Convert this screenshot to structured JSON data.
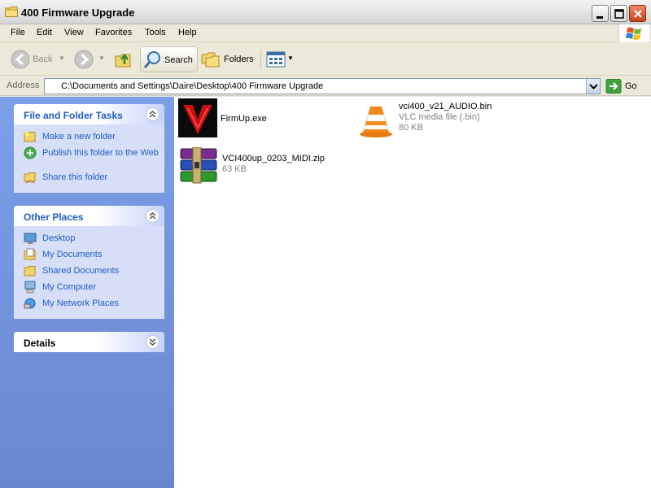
{
  "window": {
    "title": "400 Firmware Upgrade"
  },
  "menu": [
    "File",
    "Edit",
    "View",
    "Favorites",
    "Tools",
    "Help"
  ],
  "toolbar": {
    "back": "Back",
    "search": "Search",
    "folders": "Folders"
  },
  "address": {
    "label": "Address",
    "path": "C:\\Documents and Settings\\Daire\\Desktop\\400 Firmware Upgrade",
    "go": "Go"
  },
  "sidebar": {
    "tasks": {
      "title": "File and Folder Tasks",
      "items": [
        "Make a new folder",
        "Publish this folder to the Web",
        "Share this folder"
      ]
    },
    "places": {
      "title": "Other Places",
      "items": [
        "Desktop",
        "My Documents",
        "Shared Documents",
        "My Computer",
        "My Network Places"
      ]
    },
    "details": {
      "title": "Details"
    }
  },
  "files": [
    {
      "name": "FirmUp.exe",
      "type": "",
      "size": "",
      "icon": "firmup-app-icon"
    },
    {
      "name": "vci400_v21_AUDIO.bin",
      "type": "VLC media file (.bin)",
      "size": "80 KB",
      "icon": "vlc-cone-icon"
    },
    {
      "name": "VCI400up_0203_MIDI.zip",
      "type": "",
      "size": "63 KB",
      "icon": "winrar-archive-icon"
    }
  ],
  "colors": {
    "sidebar_bg": "#7BA0E8",
    "panel_bg": "#D6DFF7",
    "link": "#215DC6"
  }
}
